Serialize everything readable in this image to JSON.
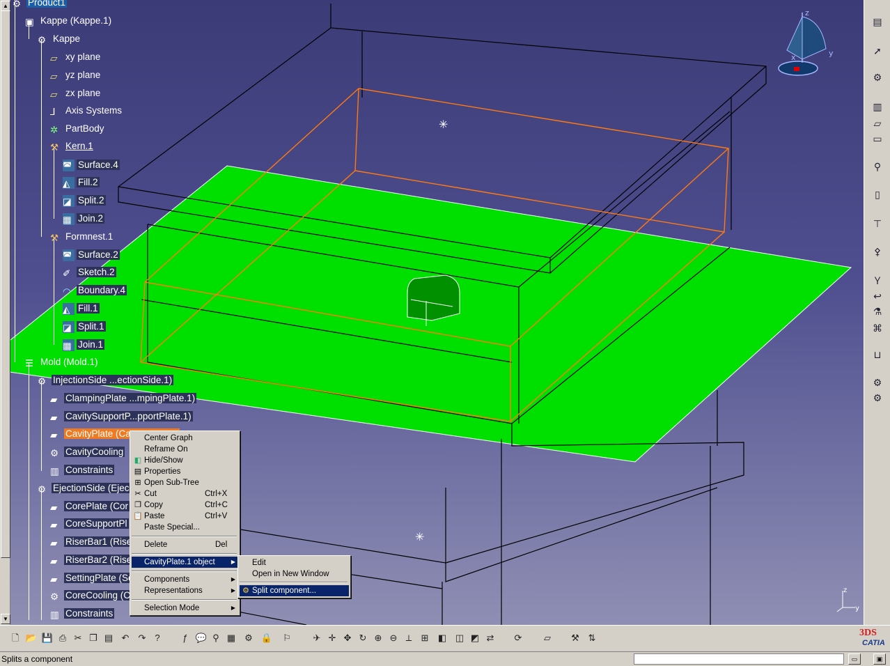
{
  "app": {
    "name": "CATIA",
    "logo_text": "CATIA"
  },
  "tree": [
    {
      "label": "Product1",
      "icon": "product-icon",
      "style": "sel-blue"
    },
    {
      "label": "Kappe (Kappe.1)",
      "icon": "part-instance-icon",
      "style": "plain"
    },
    {
      "label": "Kappe",
      "icon": "part-icon",
      "style": "plain"
    },
    {
      "label": "xy plane",
      "icon": "plane-icon",
      "style": "plain"
    },
    {
      "label": "yz plane",
      "icon": "plane-icon",
      "style": "plain"
    },
    {
      "label": "zx plane",
      "icon": "plane-icon",
      "style": "plain"
    },
    {
      "label": "Axis Systems",
      "icon": "axis-system-icon",
      "style": "plain"
    },
    {
      "label": "PartBody",
      "icon": "part-body-icon",
      "style": "plain"
    },
    {
      "label": "Kern.1",
      "icon": "geometrical-set-icon",
      "style": "underline"
    },
    {
      "label": "Surface.4",
      "icon": "surface-icon",
      "style": "boxed"
    },
    {
      "label": "Fill.2",
      "icon": "fill-icon",
      "style": "boxed"
    },
    {
      "label": "Split.2",
      "icon": "split-icon",
      "style": "boxed"
    },
    {
      "label": "Join.2",
      "icon": "join-icon",
      "style": "boxed"
    },
    {
      "label": "Formnest.1",
      "icon": "geometrical-set-icon",
      "style": "plain"
    },
    {
      "label": "Surface.2",
      "icon": "surface-icon",
      "style": "boxed"
    },
    {
      "label": "Sketch.2",
      "icon": "sketch-icon",
      "style": "boxed"
    },
    {
      "label": "Boundary.4",
      "icon": "boundary-icon",
      "style": "boxed"
    },
    {
      "label": "Fill.1",
      "icon": "fill-icon",
      "style": "boxed"
    },
    {
      "label": "Split.1",
      "icon": "split-icon",
      "style": "boxed"
    },
    {
      "label": "Join.1",
      "icon": "join-icon",
      "style": "boxed"
    },
    {
      "label": "Mold (Mold.1)",
      "icon": "mold-icon",
      "style": "plain"
    },
    {
      "label": "InjectionSide ...ectionSide.1)",
      "icon": "assembly-icon",
      "style": "boxed"
    },
    {
      "label": "ClampingPlate ...mpingPlate.1)",
      "icon": "plate-icon",
      "style": "boxed"
    },
    {
      "label": "CavitySupportP...pportPlate.1)",
      "icon": "plate-icon",
      "style": "boxed"
    },
    {
      "label": "CavityPlate (Ca",
      "icon": "plate-icon",
      "style": "selected"
    },
    {
      "label": "CavityCooling",
      "icon": "cooling-icon",
      "style": "boxed"
    },
    {
      "label": "Constraints",
      "icon": "constraints-icon",
      "style": "boxed"
    },
    {
      "label": "EjectionSide (Ejec",
      "icon": "assembly-icon",
      "style": "boxed"
    },
    {
      "label": "CorePlate (Cor",
      "icon": "plate-icon",
      "style": "boxed"
    },
    {
      "label": "CoreSupportPl",
      "icon": "plate-icon",
      "style": "boxed"
    },
    {
      "label": "RiserBar1 (Riser",
      "icon": "plate-icon",
      "style": "boxed"
    },
    {
      "label": "RiserBar2 (Riser",
      "icon": "plate-icon",
      "style": "boxed"
    },
    {
      "label": "SettingPlate (Se",
      "icon": "plate-icon",
      "style": "boxed"
    },
    {
      "label": "CoreCooling (C",
      "icon": "cooling-icon",
      "style": "boxed"
    },
    {
      "label": "Constraints",
      "icon": "constraints-icon",
      "style": "boxed"
    }
  ],
  "context_menu": {
    "items": [
      {
        "label": "Center Graph",
        "shortcut": "",
        "icon": "",
        "submenu": false
      },
      {
        "label": "Reframe On",
        "shortcut": "",
        "icon": "",
        "submenu": false
      },
      {
        "label": "Hide/Show",
        "shortcut": "",
        "icon": "hide-show-icon",
        "submenu": false
      },
      {
        "label": "Properties",
        "shortcut": "",
        "icon": "properties-icon",
        "submenu": false
      },
      {
        "label": "Open Sub-Tree",
        "shortcut": "",
        "icon": "sub-tree-icon",
        "submenu": false
      },
      {
        "label": "Cut",
        "shortcut": "Ctrl+X",
        "icon": "scissors-icon",
        "submenu": false
      },
      {
        "label": "Copy",
        "shortcut": "Ctrl+C",
        "icon": "copy-icon",
        "submenu": false
      },
      {
        "label": "Paste",
        "shortcut": "Ctrl+V",
        "icon": "paste-icon",
        "submenu": false
      },
      {
        "label": "Paste Special...",
        "shortcut": "",
        "icon": "",
        "submenu": false
      },
      {
        "label": "Delete",
        "shortcut": "Del",
        "icon": "",
        "submenu": false
      },
      {
        "label": "CavityPlate.1 object",
        "shortcut": "",
        "icon": "",
        "submenu": true
      },
      {
        "label": "Components",
        "shortcut": "",
        "icon": "",
        "submenu": true
      },
      {
        "label": "Representations",
        "shortcut": "",
        "icon": "",
        "submenu": true
      },
      {
        "label": "Selection Mode",
        "shortcut": "",
        "icon": "",
        "submenu": true
      }
    ]
  },
  "sub_menu": {
    "items": [
      {
        "label": "Edit"
      },
      {
        "label": "Open in New Window"
      },
      {
        "label": "Split component..."
      }
    ]
  },
  "compass": {
    "x": "x",
    "y": "y",
    "z": "z"
  },
  "axis_triad": {
    "z": "z",
    "y": "y"
  },
  "status": {
    "text": "Splits a component",
    "input_value": ""
  },
  "colors": {
    "background_top": "#3b3b77",
    "background_bottom": "#8f8fb4",
    "surface": "#00dd00",
    "selection": "#f07a22",
    "menu_highlight": "#0a246a"
  }
}
